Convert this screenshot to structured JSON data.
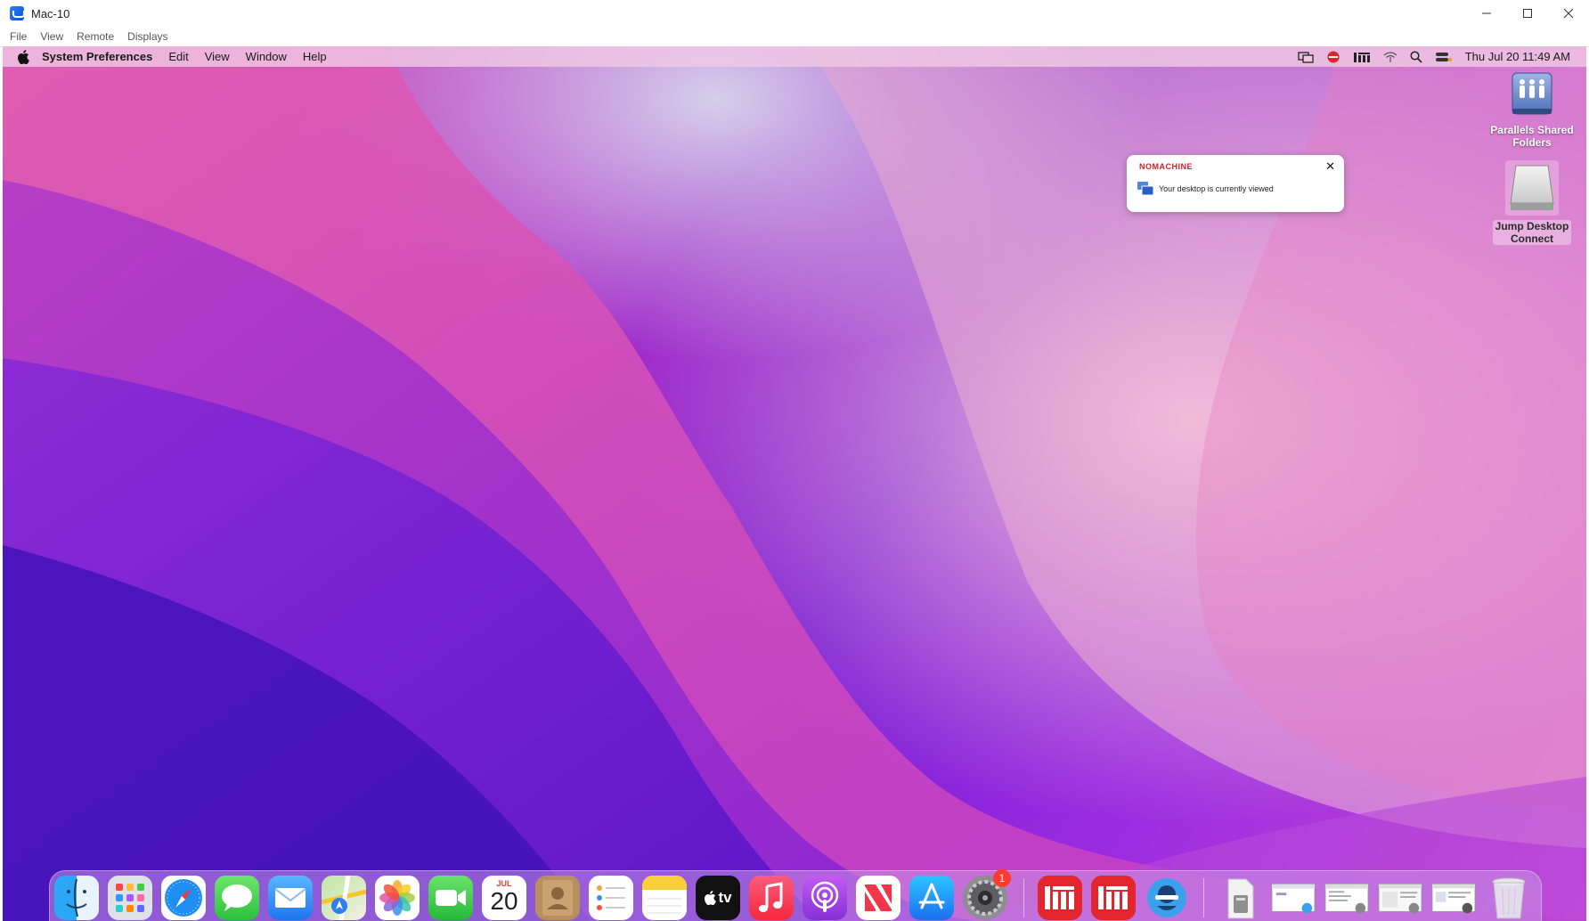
{
  "window": {
    "title": "Mac-10"
  },
  "host_menu": [
    "File",
    "View",
    "Remote",
    "Displays"
  ],
  "mac_menubar": {
    "app_name": "System Preferences",
    "menus": [
      "Edit",
      "View",
      "Window",
      "Help"
    ],
    "clock": "Thu Jul 20  11:49 AM"
  },
  "desktop_icons": [
    {
      "label1": "Parallels Shared",
      "label2": "Folders"
    },
    {
      "label1": "Jump Desktop",
      "label2": "Connect"
    }
  ],
  "notification": {
    "brand": "NOMACHINE",
    "message": "Your desktop is currently viewed"
  },
  "dock": {
    "calendar_month": "JUL",
    "calendar_day": "20",
    "tv_label": "tv",
    "system_prefs_badge": "1",
    "items": [
      "Finder",
      "Launchpad",
      "Safari",
      "Messages",
      "Mail",
      "Maps",
      "Photos",
      "FaceTime",
      "Calendar",
      "Contacts",
      "Reminders",
      "Notes",
      "TV",
      "Music",
      "Podcasts",
      "News",
      "App Store",
      "System Preferences",
      "NoMachine",
      "NoMachine",
      "Jump Desktop"
    ]
  },
  "colors": {
    "nomachine_red": "#d4202c",
    "menubar_bg": "#f0c8e4"
  }
}
